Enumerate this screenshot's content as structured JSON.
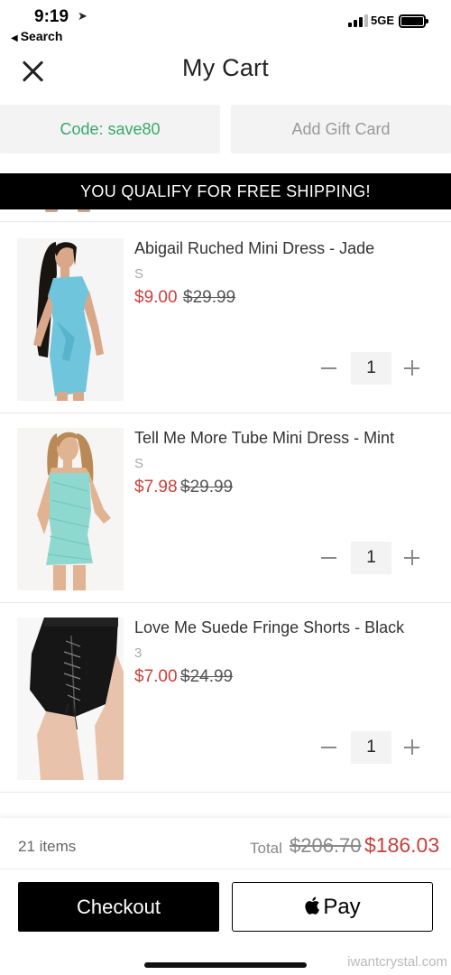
{
  "status_bar": {
    "time": "9:19",
    "location_glyph": "➤",
    "back_label": "Search",
    "network": "5GE"
  },
  "header": {
    "title": "My Cart"
  },
  "promo": {
    "code_label": "Code: save80",
    "gift_card_label": "Add Gift Card"
  },
  "banner": {
    "text": "YOU QUALIFY FOR FREE SHIPPING!"
  },
  "items": [
    {
      "name": "Abigail Ruched Mini Dress - Jade",
      "size": "S",
      "price": "$9.00",
      "original_price": "$29.99",
      "quantity": "1",
      "product_color": "#6ec5dc"
    },
    {
      "name": "Tell Me More Tube Mini Dress - Mint",
      "size": "S",
      "price": "$7.98",
      "original_price": "$29.99",
      "quantity": "1",
      "product_color": "#8fd8cf"
    },
    {
      "name": "Love Me Suede Fringe Shorts - Black",
      "size": "3",
      "price": "$7.00",
      "original_price": "$24.99",
      "quantity": "1",
      "product_color": "#161616"
    }
  ],
  "footer": {
    "item_count": "21 items",
    "total_label": "Total",
    "total_original": "$206.70",
    "total": "$186.03",
    "checkout_label": "Checkout",
    "applepay_label": "Pay"
  },
  "watermark": "iwantcrystal.com",
  "colors": {
    "promo_green": "#3aa86a",
    "sale_red": "#c8403a",
    "banner_black": "#000000"
  }
}
